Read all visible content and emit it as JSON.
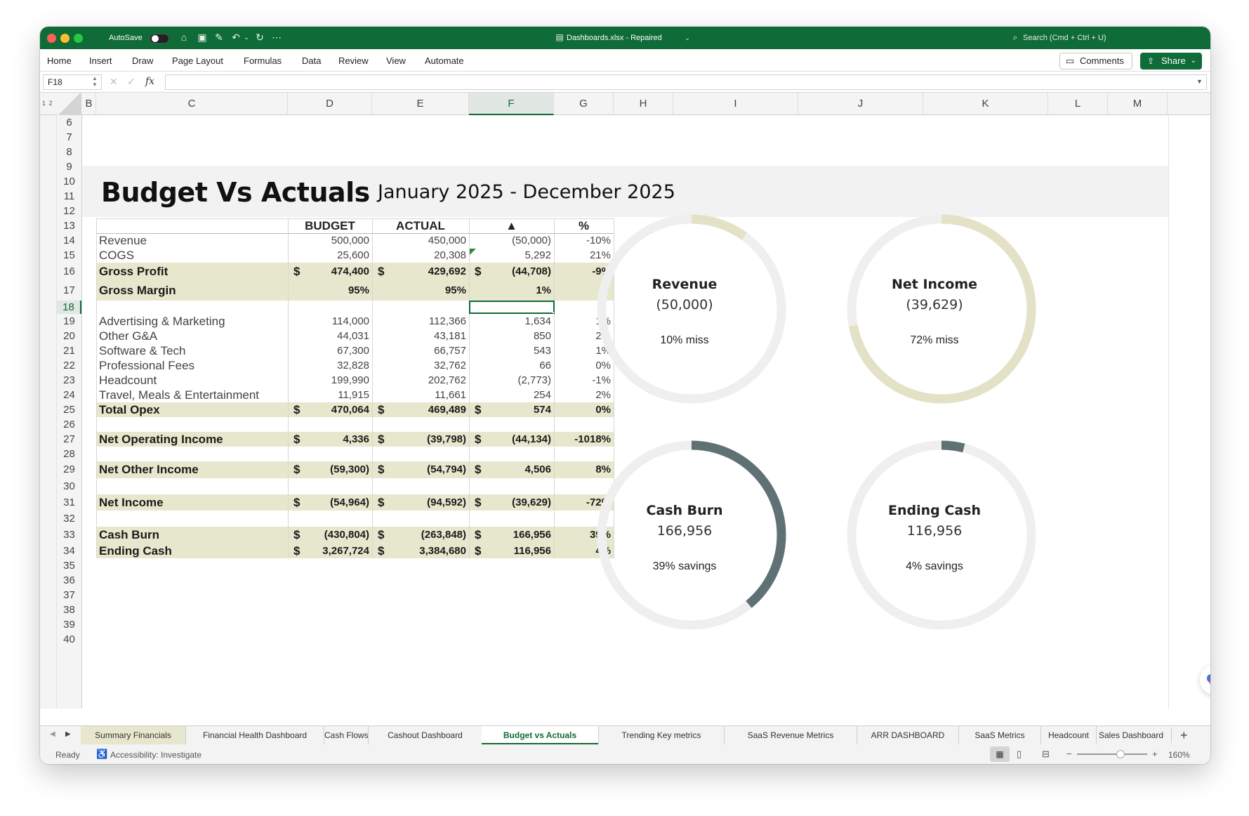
{
  "titlebar": {
    "autosave_label": "AutoSave",
    "file_title": "Dashboards.xlsx  -  Repaired",
    "search_placeholder": "Search (Cmd + Ctrl + U)"
  },
  "menu": {
    "items": [
      "Home",
      "Insert",
      "Draw",
      "Page Layout",
      "Formulas",
      "Data",
      "Review",
      "View",
      "Automate"
    ],
    "comments_label": "Comments",
    "share_label": "Share"
  },
  "formula_bar": {
    "name_box": "F18",
    "fx_label": "fx"
  },
  "outline_levels": "1 2",
  "columns": [
    "B",
    "C",
    "D",
    "E",
    "F",
    "G",
    "H",
    "I",
    "J",
    "K",
    "L",
    "M"
  ],
  "selected_column": "F",
  "rows": [
    "6",
    "7",
    "8",
    "9",
    "10",
    "11",
    "12",
    "13",
    "14",
    "15",
    "16",
    "17",
    "18",
    "19",
    "20",
    "21",
    "22",
    "23",
    "24",
    "25",
    "26",
    "27",
    "28",
    "29",
    "30",
    "31",
    "32",
    "33",
    "34",
    "35",
    "36",
    "37",
    "38",
    "39",
    "40"
  ],
  "selected_row": "18",
  "report": {
    "title": "Budget Vs Actuals",
    "period": "January 2025 - December 2025",
    "headers": {
      "budget": "BUDGET",
      "actual": "ACTUAL",
      "delta": "▲",
      "pct": "%"
    },
    "currency_symbol": "$",
    "lines": [
      {
        "label": "Revenue",
        "budget": "500,000",
        "actual": "450,000",
        "delta": "(50,000)",
        "pct": "-10%"
      },
      {
        "label": "COGS",
        "budget": "25,600",
        "actual": "20,308",
        "delta": "5,292",
        "pct": "21%"
      },
      {
        "label": "Gross Profit",
        "budget": "474,400",
        "actual": "429,692",
        "delta": "(44,708)",
        "pct": "-9%"
      },
      {
        "label": "Gross Margin",
        "budget": "95%",
        "actual": "95%",
        "delta": "1%",
        "pct": ""
      },
      {
        "label": "Advertising & Marketing",
        "budget": "114,000",
        "actual": "112,366",
        "delta": "1,634",
        "pct": "1%"
      },
      {
        "label": "Other G&A",
        "budget": "44,031",
        "actual": "43,181",
        "delta": "850",
        "pct": "2%"
      },
      {
        "label": "Software & Tech",
        "budget": "67,300",
        "actual": "66,757",
        "delta": "543",
        "pct": "1%"
      },
      {
        "label": "Professional Fees",
        "budget": "32,828",
        "actual": "32,762",
        "delta": "66",
        "pct": "0%"
      },
      {
        "label": "Headcount",
        "budget": "199,990",
        "actual": "202,762",
        "delta": "(2,773)",
        "pct": "-1%"
      },
      {
        "label": "Travel, Meals & Entertainment",
        "budget": "11,915",
        "actual": "11,661",
        "delta": "254",
        "pct": "2%"
      },
      {
        "label": "Total Opex",
        "budget": "470,064",
        "actual": "469,489",
        "delta": "574",
        "pct": "0%"
      },
      {
        "label": "Net Operating Income",
        "budget": "4,336",
        "actual": "(39,798)",
        "delta": "(44,134)",
        "pct": "-1018%"
      },
      {
        "label": "Net Other Income",
        "budget": "(59,300)",
        "actual": "(54,794)",
        "delta": "4,506",
        "pct": "8%"
      },
      {
        "label": "Net Income",
        "budget": "(54,964)",
        "actual": "(94,592)",
        "delta": "(39,629)",
        "pct": "-72%"
      },
      {
        "label": "Cash Burn",
        "budget": "(430,804)",
        "actual": "(263,848)",
        "delta": "166,956",
        "pct": "39%"
      },
      {
        "label": "Ending Cash",
        "budget": "3,267,724",
        "actual": "3,384,680",
        "delta": "116,956",
        "pct": "4%"
      }
    ]
  },
  "rings": [
    {
      "title": "Revenue",
      "value": "(50,000)",
      "caption": "10% miss",
      "fraction": 0.1,
      "color": "#e3e2c6"
    },
    {
      "title": "Net Income",
      "value": "(39,629)",
      "caption": "72% miss",
      "fraction": 0.72,
      "color": "#e3e2c6"
    },
    {
      "title": "Cash Burn",
      "value": "166,956",
      "caption": "39% savings",
      "fraction": 0.39,
      "color": "#5f7175"
    },
    {
      "title": "Ending Cash",
      "value": "116,956",
      "caption": "4% savings",
      "fraction": 0.04,
      "color": "#5f7175"
    }
  ],
  "sheet_tabs": [
    "Summary Financials",
    "Financial Health Dashboard",
    "Cash Flows",
    "Cashout Dashboard",
    "Budget vs Actuals",
    "Trending Key metrics",
    "SaaS Revenue Metrics",
    "ARR DASHBOARD",
    "SaaS Metrics",
    "Headcount",
    "Sales Dashboard"
  ],
  "active_sheet": "Budget vs Actuals",
  "add_sheet_label": "+",
  "status": {
    "ready": "Ready",
    "accessibility": "Accessibility: Investigate",
    "zoom": "160%"
  }
}
